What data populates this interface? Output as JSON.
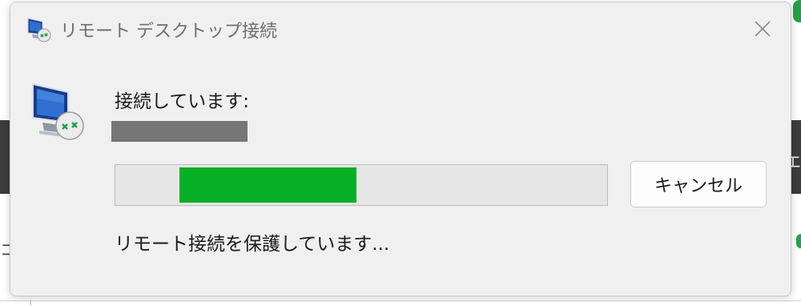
{
  "window": {
    "title": "リモート デスクトップ接続",
    "title_icon": "remote-desktop-icon",
    "close_icon": "close-icon"
  },
  "main": {
    "icon": "remote-desktop-computer-icon",
    "connecting_label": "接続しています:",
    "host_redacted": "",
    "progress": {
      "start_fraction": 0.13,
      "end_fraction": 0.49,
      "color": "#06b025"
    },
    "cancel_label": "キャンセル",
    "status_text": "リモート接続を保護しています..."
  }
}
